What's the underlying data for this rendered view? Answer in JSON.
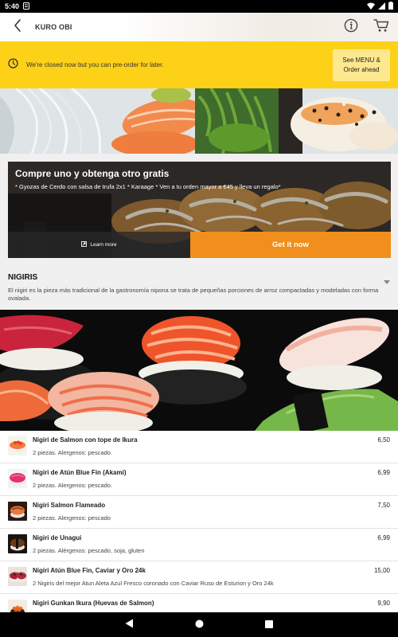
{
  "status_bar": {
    "time": "5:40"
  },
  "header": {
    "title": "KURO OBI"
  },
  "banner": {
    "message": "We're closed now but you can pre-order for later.",
    "button_line1": "See MENU &",
    "button_line2": "Order ahead"
  },
  "promo": {
    "title": "Compre uno y obtenga otro gratis",
    "subtitle": "* Gyozas de Cerdo con salsa de trufa 2x1 * Karaage * Ven a tu orden mayor a €45 y lleva un regalo*",
    "learn_more": "Learn more",
    "cta": "Get it now"
  },
  "category": {
    "title": "NIGIRIS",
    "description": "El nigiri es la pieza más tradicional de la gastronomía nipona se trata de pequeñas porciones de arroz compactadas y modeladas con forma ovalada."
  },
  "menu_items": [
    {
      "name": "Nigiri de Salmon con tope de Ikura",
      "description": "2 piezas. Alergenos: pescado.",
      "price": "6,50"
    },
    {
      "name": "Nigiri de Atún Blue Fin (Akami)",
      "description": "2 piezas. Alergenos: pescado.",
      "price": "6,99"
    },
    {
      "name": "Nigiri Salmon Flameado",
      "description": "2 piezas. Alergenos: pescado",
      "price": "7,50"
    },
    {
      "name": "Nigiri de Unagui",
      "description": "2 piezas. Alérgenos: pescado, soja, gluten",
      "price": "6,99"
    },
    {
      "name": "Nigiri Atún Blue Fin, Caviar y Oro 24k",
      "description": "2 Nigiris del mejor Atun Aleta Azul Fresco coronado con Caviar Ruso de Esturion y Oro 24k",
      "price": "15,00"
    },
    {
      "name": "Nigiri Gunkan Ikura (Huevas de Salmon)",
      "description": "",
      "price": "9,90"
    }
  ],
  "colors": {
    "banner_yellow": "#fdd118",
    "cta_orange": "#f08f1c",
    "section_gray": "#f0f0f0"
  },
  "icons": {
    "back": "back-arrow-icon",
    "info": "info-icon",
    "cart": "cart-icon",
    "clock": "clock-icon",
    "chevron": "chevron-down-icon"
  }
}
